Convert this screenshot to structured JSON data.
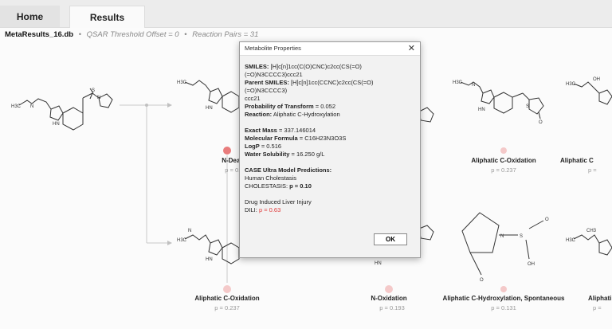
{
  "tabs": [
    {
      "label": "Home"
    },
    {
      "label": "Results"
    }
  ],
  "infobar": {
    "db_name": "MetaResults_16.db",
    "threshold": "QSAR Threshold Offset = 0",
    "pairs": "Reaction Pairs = 31",
    "separator": "•"
  },
  "nodes": [
    {
      "label": "N-Dealkylat",
      "p": "p = 0.488"
    },
    {
      "label": "Aliphatic C-Oxidation",
      "p": "p = 0.237"
    },
    {
      "label": "Aliphatic C",
      "p": "p ="
    },
    {
      "label": "Aliphatic C-Oxidation",
      "p": "p = 0.237"
    },
    {
      "label": "N-Oxidation",
      "p": "p = 0.193"
    },
    {
      "label": "Aliphatic C-Hydroxylation, Spontaneous",
      "p": "p = 0.131"
    },
    {
      "label": "Aliphati",
      "p": "p ="
    }
  ],
  "chem": {
    "h3c": "H3C",
    "ch3": "CH3",
    "n": "N",
    "o": "O",
    "s": "S",
    "hn": "HN",
    "oh": "OH"
  },
  "dialog": {
    "title": "Metabolite Properties",
    "close": "✕",
    "smiles_label": "SMILES:",
    "smiles_value": "[H]c[n]1cc(C(O)CNC)c2cc(CS(=O)(=O)N3CCCC3)ccc21",
    "parent_label": "Parent SMILES:",
    "parent_value1": "[H]c[n]1cc(CCNC)c2cc(CS(=O)(=O)N3CCCC3)",
    "parent_value2": "ccc21",
    "prob_label": "Probability of Transform",
    "prob_value": "= 0.052",
    "reaction_label": "Reaction:",
    "reaction_value": "Aliphatic C-Hydroxylation",
    "mass_label": "Exact Mass",
    "mass_value": "= 337.146014",
    "formula_label": "Molecular Formula",
    "formula_value": "= C16H23N3O3S",
    "logp_label": "LogP",
    "logp_value": "= 0.516",
    "sol_label": "Water Solubility",
    "sol_value": "= 16.250 g/L",
    "case_title": "CASE Ultra Model Predictions:",
    "cholestasis_title": "Human Cholestasis",
    "cholestasis_label": "CHOLESTASIS:",
    "cholestasis_value": "p = 0.10",
    "dili_title": "Drug Induced Liver Injury",
    "dili_label": "DILI:",
    "dili_value": "p = 0.63",
    "ok_label": "OK"
  },
  "colors": {
    "dot_red": "#e87c7c",
    "dot_pink": "#f4c9c9",
    "p_red": "#e03a3a"
  }
}
